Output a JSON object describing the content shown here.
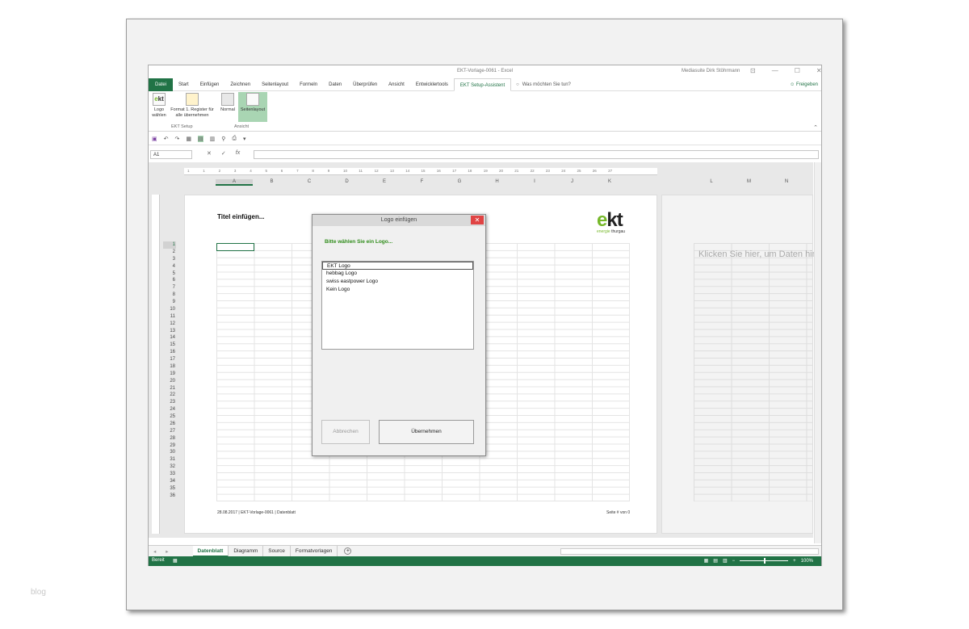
{
  "watermark": "blog",
  "window": {
    "title": "EKT-Vorlage-0061 - Excel",
    "user": "Mediasuite Dirk Stöhrmann",
    "controls": [
      "⊡",
      "—",
      "☐",
      "✕"
    ]
  },
  "ribbon_tabs": [
    "Datei",
    "Start",
    "Einfügen",
    "Zeichnen",
    "Seitenlayout",
    "Formeln",
    "Daten",
    "Überprüfen",
    "Ansicht",
    "Entwicklertools",
    "EKT Setup-Assistent"
  ],
  "active_tab": "EKT Setup-Assistent",
  "tell_me": "Was möchten Sie tun?",
  "share": "Freigeben",
  "ribbon": {
    "logo_btn": "Logo wählen",
    "format_btn": "Format 1. Register für alle übernehmen",
    "group1": "EKT Setup",
    "normal_btn": "Normal",
    "layout_btn": "Seitenlayout",
    "group2": "Ansicht"
  },
  "namebox": "A1",
  "formula_icons": [
    "✕",
    "✓",
    "fx"
  ],
  "ruler_ticks": [
    "1",
    "1",
    "2",
    "3",
    "4",
    "5",
    "6",
    "7",
    "8",
    "9",
    "10",
    "11",
    "12",
    "13",
    "14",
    "15",
    "16",
    "17",
    "18",
    "19",
    "20",
    "21",
    "22",
    "23",
    "24",
    "25",
    "26",
    "27"
  ],
  "columns": [
    "A",
    "B",
    "C",
    "D",
    "E",
    "F",
    "G",
    "H",
    "I",
    "J",
    "K"
  ],
  "columns2": [
    "L",
    "M",
    "N"
  ],
  "rows": [
    "1",
    "2",
    "3",
    "4",
    "5",
    "6",
    "7",
    "8",
    "9",
    "10",
    "11",
    "12",
    "13",
    "14",
    "15",
    "16",
    "17",
    "18",
    "19",
    "20",
    "21",
    "22",
    "23",
    "24",
    "25",
    "26",
    "27",
    "28",
    "29",
    "30",
    "31",
    "32",
    "33",
    "34",
    "35",
    "36"
  ],
  "page": {
    "title": "Titel einfügen...",
    "logo_e": "e",
    "logo_kt": "kt",
    "logo_sub1": "energie",
    "logo_sub2": " thurgau",
    "footer_left": "28.08.2017 | EKT-Vorlage-0061 | Datenblatt",
    "footer_right": "Seite # von 0",
    "click_hint": "Klicken Sie hier, um Daten hin"
  },
  "sheet_tabs": [
    "Datenblatt",
    "Diagramm",
    "Source",
    "Formatvorlagen"
  ],
  "active_sheet": "Datenblatt",
  "status": {
    "ready": "Bereit",
    "zoom": "100%"
  },
  "dialog": {
    "title": "Logo einfügen",
    "prompt": "Bitte wählen Sie ein Logo...",
    "options": [
      "EKT Logo",
      "hebbag Logo",
      "swiss eastpower Logo",
      "Kein Logo"
    ],
    "selected": "EKT Logo",
    "cancel": "Abbrechen",
    "ok": "Übernehmen"
  },
  "colors": {
    "excel_green": "#217346",
    "ekt_green": "#76b82a"
  }
}
